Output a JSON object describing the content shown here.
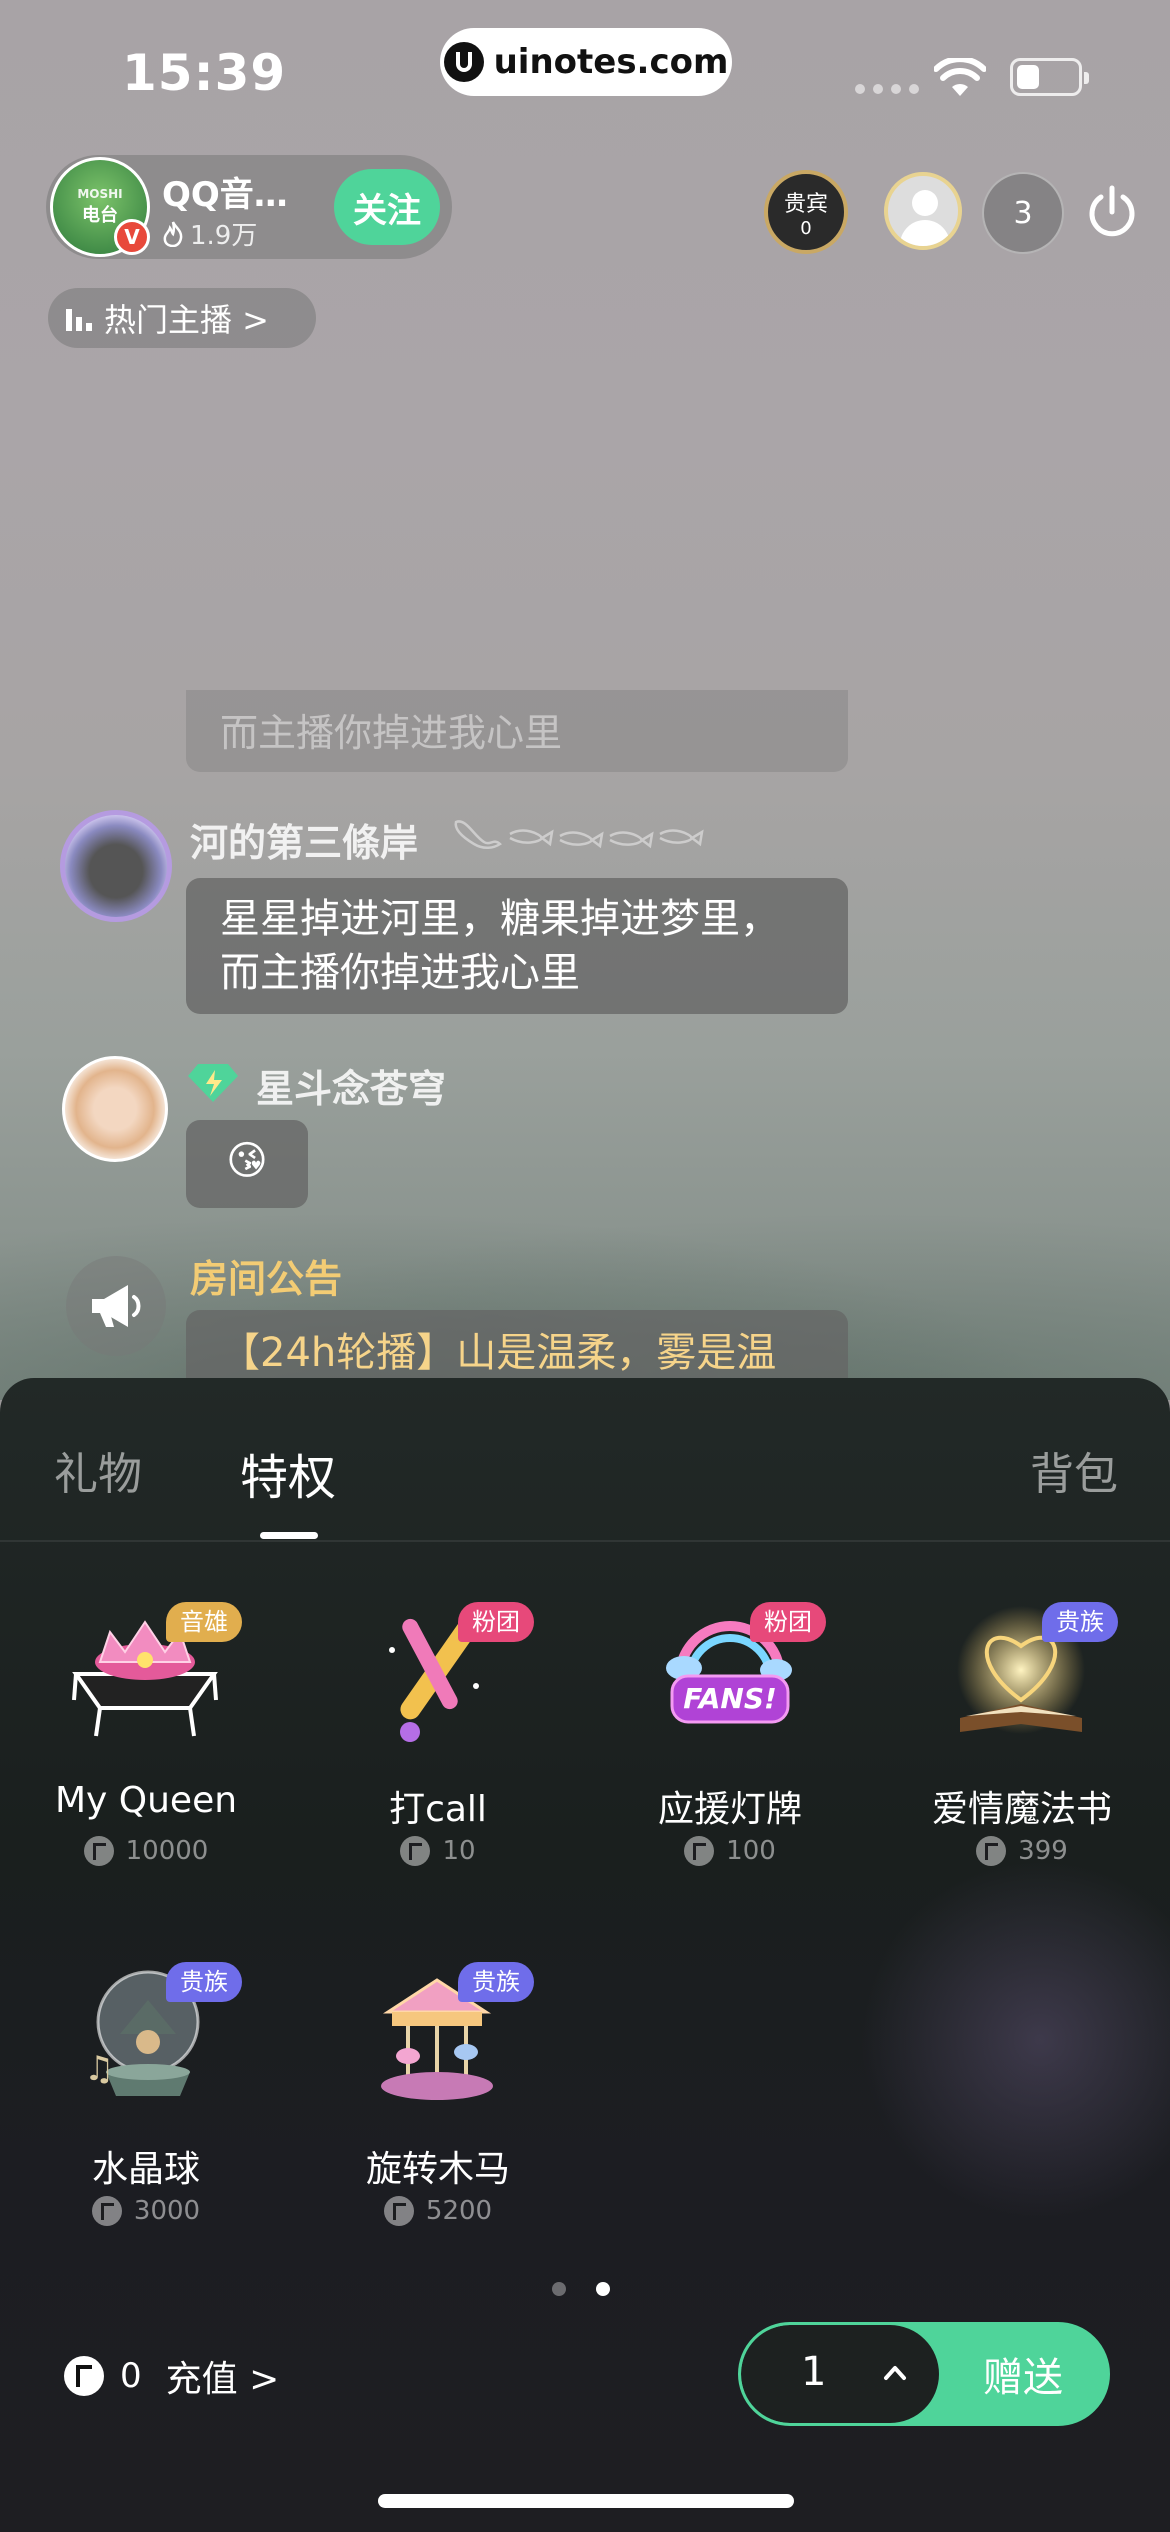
{
  "status": {
    "time": "15:39",
    "url": "uinotes.com"
  },
  "host": {
    "name": "QQ音…",
    "fans": "1.9万",
    "follow_label": "关注",
    "avatar_text": "电台",
    "verified": "V"
  },
  "top_right": {
    "vip_label": "贵宾",
    "vip_count": "0",
    "viewer_count": "3"
  },
  "hot_label": "热门主播 >",
  "chat": {
    "faded_text": "而主播你掉进我心里",
    "messages": [
      {
        "user": "河的第三條岸",
        "text_line1": "星星掉进河里，糖果掉进梦里，",
        "text_line2": "而主播你掉进我心里"
      },
      {
        "user": "星斗念苍穹",
        "text": "😘"
      }
    ],
    "announcement": {
      "title": "房间公告",
      "text": "【24h轮播】山是温柔，雾是温"
    }
  },
  "panel": {
    "tabs": [
      {
        "label": "礼物"
      },
      {
        "label": "特权"
      },
      {
        "label": "背包"
      }
    ],
    "gifts": [
      {
        "name": "My Queen",
        "price": "10000",
        "tag": "音雄",
        "tag_color": "#e1ae4e",
        "icon": "crown-stage-icon"
      },
      {
        "name": "打call",
        "price": "10",
        "tag": "粉团",
        "tag_color": "#e7497a",
        "icon": "glowstick-icon"
      },
      {
        "name": "应援灯牌",
        "price": "100",
        "tag": "粉团",
        "tag_color": "#e7497a",
        "icon": "fans-sign-icon"
      },
      {
        "name": "爱情魔法书",
        "price": "399",
        "tag": "贵族",
        "tag_color": "#6f6dea",
        "icon": "magic-book-icon"
      },
      {
        "name": "水晶球",
        "price": "3000",
        "tag": "贵族",
        "tag_color": "#6f6dea",
        "icon": "crystal-ball-icon"
      },
      {
        "name": "旋转木马",
        "price": "5200",
        "tag": "贵族",
        "tag_color": "#6f6dea",
        "icon": "carousel-icon"
      }
    ],
    "balance": "0",
    "recharge_label": "充值 >",
    "quantity": "1",
    "send_label": "赠送"
  }
}
